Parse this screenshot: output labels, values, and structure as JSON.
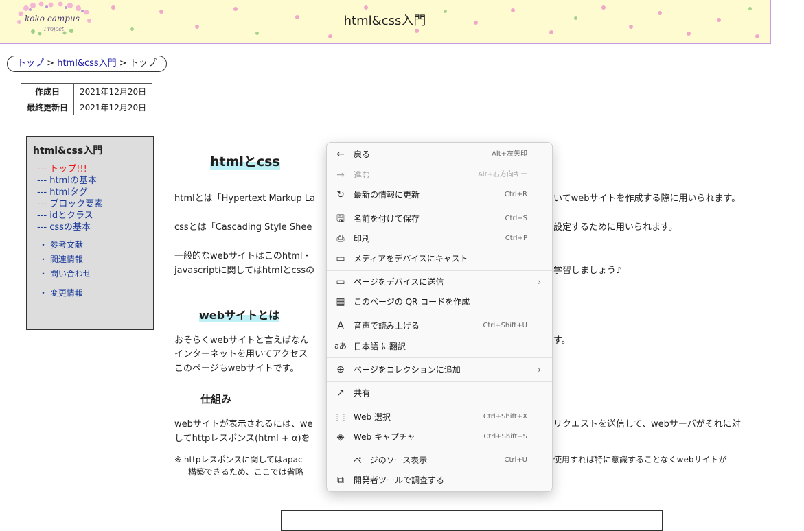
{
  "header": {
    "logo_text": "koko-campus",
    "logo_sub": "Project",
    "title": "html&css入門"
  },
  "breadcrumb": {
    "items": [
      "トップ",
      ">",
      "html&css入門",
      ">",
      "トップ"
    ]
  },
  "dates": {
    "created_label": "作成日",
    "created_value": "2021年12月20日",
    "updated_label": "最終更新日",
    "updated_value": "2021年12月20日"
  },
  "sidebar": {
    "title": "html&css入門",
    "items": [
      "--- トップ!!!",
      "--- htmlの基本",
      "--- htmlタグ",
      "--- ブロック要素",
      "--- idとクラス",
      "--- cssの基本"
    ],
    "links": [
      "・ 参考文献",
      "・ 関連情報",
      "・ 問い合わせ",
      "・ 変更情報"
    ]
  },
  "main": {
    "h_html_css": "htmlとcss",
    "p1": "htmlとは「Hypertext Markup La",
    "p1_end": "いてwebサイトを作成する際に用いられます。",
    "p2": "cssとは「Cascading Style Shee",
    "p2_end": "設定するために用いられます。",
    "p3a": "一般的なwebサイトはこのhtml・",
    "p3b": "javascriptに関してはhtmlとcssの",
    "p3b_end": "学習しましょう♪",
    "h_website": "webサイトとは",
    "p4a": "おそらくwebサイトと言えばなん",
    "p4a_end": "す。",
    "p4b": "インターネットを用いてアクセス",
    "p4c": "このページもwebサイトです。",
    "h_mechanism": "仕組み",
    "p5a": "webサイトが表示されるには、we",
    "p5a_end": "リクエストを送信して、webサーバがそれに対",
    "p5b": "してhttpレスポンス(html + α)を",
    "note_a": "※ httpレスポンスに関してはapac",
    "note_a_end": "使用すれば特に意識することなくwebサイトが",
    "note_b": "構築できるため、ここでは省略"
  },
  "context_menu": {
    "items": [
      {
        "icon": "back-arrow-icon",
        "glyph": "←",
        "label": "戻る",
        "shortcut": "Alt+左矢印"
      },
      {
        "icon": "forward-arrow-icon",
        "glyph": "→",
        "label": "進む",
        "shortcut": "Alt+右方向キー"
      },
      {
        "icon": "refresh-icon",
        "glyph": "↻",
        "label": "最新の情報に更新",
        "shortcut": "Ctrl+R"
      },
      {
        "icon": "save-as-icon",
        "glyph": "🖫",
        "label": "名前を付けて保存",
        "shortcut": "Ctrl+S"
      },
      {
        "icon": "print-icon",
        "glyph": "⎙",
        "label": "印刷",
        "shortcut": "Ctrl+P"
      },
      {
        "icon": "cast-icon",
        "glyph": "▭",
        "label": "メディアをデバイスにキャスト",
        "shortcut": ""
      },
      {
        "icon": "send-to-device-icon",
        "glyph": "▭",
        "label": "ページをデバイスに送信",
        "shortcut": ""
      },
      {
        "icon": "qr-code-icon",
        "glyph": "▦",
        "label": "このページの QR コードを作成",
        "shortcut": ""
      },
      {
        "icon": "read-aloud-icon",
        "glyph": "A",
        "label": "音声で読み上げる",
        "shortcut": "Ctrl+Shift+U"
      },
      {
        "icon": "translate-icon",
        "glyph": "aあ",
        "label": "日本語 に翻訳",
        "shortcut": ""
      },
      {
        "icon": "add-to-collection-icon",
        "glyph": "⊕",
        "label": "ページをコレクションに追加",
        "shortcut": ""
      },
      {
        "icon": "share-icon",
        "glyph": "↗",
        "label": "共有",
        "shortcut": ""
      },
      {
        "icon": "web-select-icon",
        "glyph": "⬚",
        "label": "Web 選択",
        "shortcut": "Ctrl+Shift+X"
      },
      {
        "icon": "web-capture-icon",
        "glyph": "◈",
        "label": "Web キャプチャ",
        "shortcut": "Ctrl+Shift+S"
      },
      {
        "icon": "",
        "glyph": "",
        "label": "ページのソース表示",
        "shortcut": "Ctrl+U"
      },
      {
        "icon": "devtools-icon",
        "glyph": "⧉",
        "label": "開発者ツールで調査する",
        "shortcut": ""
      }
    ],
    "submenu_arrow": "›"
  }
}
